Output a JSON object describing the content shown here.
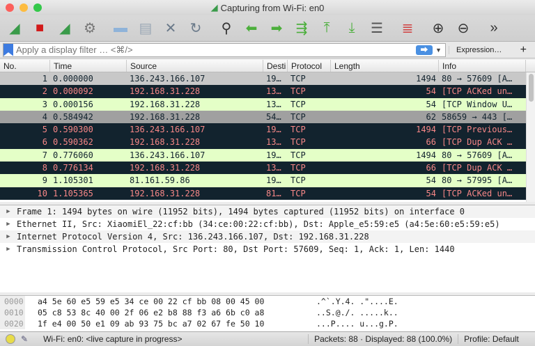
{
  "window": {
    "title": "Capturing from Wi-Fi: en0"
  },
  "toolbar": {
    "buttons": [
      {
        "name": "start-capture",
        "icon": "shark-fin-icon",
        "glyph": "◢",
        "color": "#3a9b4a"
      },
      {
        "name": "stop-capture",
        "icon": "stop-icon",
        "glyph": "■",
        "color": "#d21a1a"
      },
      {
        "name": "restart-capture",
        "icon": "restart-fin-icon",
        "glyph": "◢",
        "color": "#3a9b4a"
      },
      {
        "name": "capture-options",
        "icon": "gear-icon",
        "glyph": "⚙",
        "color": "#777"
      },
      {
        "name": "open-file",
        "icon": "folder-icon",
        "glyph": "▬",
        "color": "#8fb3d9"
      },
      {
        "name": "save-file",
        "icon": "file-icon",
        "glyph": "▤",
        "color": "#9aa7b5"
      },
      {
        "name": "close-file",
        "icon": "close-file-icon",
        "glyph": "✕",
        "color": "#6b7a8a"
      },
      {
        "name": "reload-file",
        "icon": "reload-icon",
        "glyph": "↻",
        "color": "#6b7a8a"
      },
      {
        "name": "find-packet",
        "icon": "search-icon",
        "glyph": "⚲",
        "color": "#333"
      },
      {
        "name": "go-back",
        "icon": "arrow-left-icon",
        "glyph": "⬅",
        "color": "#4caf3c"
      },
      {
        "name": "go-forward",
        "icon": "arrow-right-icon",
        "glyph": "➡",
        "color": "#4caf3c"
      },
      {
        "name": "go-to-packet",
        "icon": "go-to-packet-icon",
        "glyph": "⇶",
        "color": "#4caf3c"
      },
      {
        "name": "first-packet",
        "icon": "arrow-up-bar-icon",
        "glyph": "⤒",
        "color": "#4caf3c"
      },
      {
        "name": "last-packet",
        "icon": "arrow-down-bar-icon",
        "glyph": "⤓",
        "color": "#4caf3c"
      },
      {
        "name": "autoscroll",
        "icon": "autoscroll-icon",
        "glyph": "☰",
        "color": "#555"
      },
      {
        "name": "colorize",
        "icon": "colorize-icon",
        "glyph": "≣",
        "color": "#d04040"
      },
      {
        "name": "zoom-in",
        "icon": "zoom-in-icon",
        "glyph": "⊕",
        "color": "#333"
      },
      {
        "name": "zoom-out",
        "icon": "zoom-out-icon",
        "glyph": "⊖",
        "color": "#333"
      },
      {
        "name": "more",
        "icon": "chevron-double-right-icon",
        "glyph": "»",
        "color": "#333"
      }
    ]
  },
  "filter": {
    "placeholder": "Apply a display filter … <⌘/>",
    "expression_label": "Expression…",
    "add_label": "+",
    "apply_glyph": "⮕"
  },
  "packet_list": {
    "columns": [
      "No.",
      "Time",
      "Source",
      "Desti",
      "Protocol",
      "Length",
      "Info"
    ],
    "rows": [
      {
        "no": "1",
        "time": "0.000000",
        "source": "136.243.166.107",
        "dest": "19…",
        "proto": "TCP",
        "len": "1494",
        "info": "80 → 57609 [A…",
        "style": "sel"
      },
      {
        "no": "2",
        "time": "0.000092",
        "source": "192.168.31.228",
        "dest": "13…",
        "proto": "TCP",
        "len": "54",
        "info": "[TCP ACKed un…",
        "style": "dark"
      },
      {
        "no": "3",
        "time": "0.000156",
        "source": "192.168.31.228",
        "dest": "13…",
        "proto": "TCP",
        "len": "54",
        "info": "[TCP Window U…",
        "style": "green"
      },
      {
        "no": "4",
        "time": "0.584942",
        "source": "192.168.31.228",
        "dest": "54…",
        "proto": "TCP",
        "len": "62",
        "info": "58659 → 443 […",
        "style": "grey"
      },
      {
        "no": "5",
        "time": "0.590300",
        "source": "136.243.166.107",
        "dest": "19…",
        "proto": "TCP",
        "len": "1494",
        "info": "[TCP Previous…",
        "style": "dark"
      },
      {
        "no": "6",
        "time": "0.590362",
        "source": "192.168.31.228",
        "dest": "13…",
        "proto": "TCP",
        "len": "66",
        "info": "[TCP Dup ACK …",
        "style": "dark"
      },
      {
        "no": "7",
        "time": "0.776060",
        "source": "136.243.166.107",
        "dest": "19…",
        "proto": "TCP",
        "len": "1494",
        "info": "80 → 57609 [A…",
        "style": "green"
      },
      {
        "no": "8",
        "time": "0.776134",
        "source": "192.168.31.228",
        "dest": "13…",
        "proto": "TCP",
        "len": "66",
        "info": "[TCP Dup ACK …",
        "style": "dark"
      },
      {
        "no": "9",
        "time": "1.105301",
        "source": "81.161.59.86",
        "dest": "19…",
        "proto": "TCP",
        "len": "54",
        "info": "80 → 57995 [A…",
        "style": "green"
      },
      {
        "no": "10",
        "time": "1.105365",
        "source": "192.168.31.228",
        "dest": "81…",
        "proto": "TCP",
        "len": "54",
        "info": "[TCP ACKed un…",
        "style": "dark"
      }
    ]
  },
  "details": [
    "Frame 1: 1494 bytes on wire (11952 bits), 1494 bytes captured (11952 bits) on interface 0",
    "Ethernet II, Src: XiaomiEl_22:cf:bb (34:ce:00:22:cf:bb), Dst: Apple_e5:59:e5 (a4:5e:60:e5:59:e5)",
    "Internet Protocol Version 4, Src: 136.243.166.107, Dst: 192.168.31.228",
    "Transmission Control Protocol, Src Port: 80, Dst Port: 57609, Seq: 1, Ack: 1, Len: 1440"
  ],
  "hex": [
    {
      "offset": "0000",
      "bytes": "a4 5e 60 e5 59 e5 34 ce  00 22 cf bb 08 00 45 00",
      "ascii": ".^`.Y.4. .\"....E."
    },
    {
      "offset": "0010",
      "bytes": "05 c8 53 8c 40 00 2f 06  e2 b8 88 f3 a6 6b c0 a8",
      "ascii": "..S.@./. .....k.."
    },
    {
      "offset": "0020",
      "bytes": "1f e4 00 50 e1 09 ab 93  75 bc a7 02 67 fe 50 10",
      "ascii": "...P.... u...g.P."
    }
  ],
  "status": {
    "interface": "Wi-Fi: en0: <live capture in progress>",
    "packets": "Packets: 88 · Displayed: 88 (100.0%)",
    "profile": "Profile: Default",
    "indicator_color": "#e8dc4a"
  }
}
